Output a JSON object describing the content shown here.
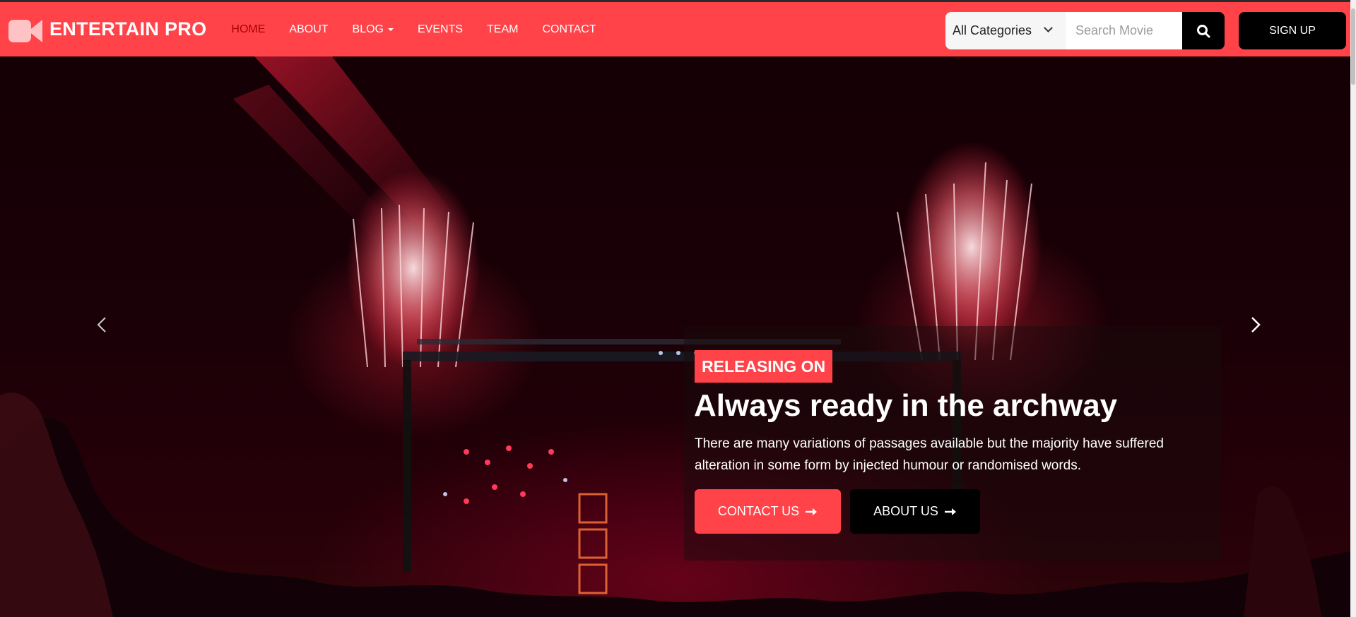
{
  "header": {
    "logo_text": "ENTERTAIN PRO",
    "logo_icon": "video-camera-icon",
    "nav": [
      {
        "label": "HOME",
        "active": true
      },
      {
        "label": "ABOUT",
        "active": false
      },
      {
        "label": "BLOG",
        "active": false,
        "has_dropdown": true
      },
      {
        "label": "EVENTS",
        "active": false
      },
      {
        "label": "TEAM",
        "active": false
      },
      {
        "label": "CONTACT",
        "active": false
      }
    ],
    "category_select": "All Categories",
    "search_placeholder": "Search Movie",
    "search_icon": "search-icon",
    "signup_label": "SIGN UP"
  },
  "hero": {
    "badge": "RELEASING ON",
    "title": "Always ready in the archway",
    "description": "There are many variations of passages available but the majority have suffered alteration in some form by injected humour or randomised words.",
    "buttons": {
      "contact": "CONTACT US",
      "about": "ABOUT US"
    },
    "prev_icon": "chevron-left-icon",
    "next_icon": "chevron-right-icon"
  },
  "colors": {
    "brand": "#ff4349",
    "nav_active": "#a80007",
    "dark": "#000000"
  }
}
